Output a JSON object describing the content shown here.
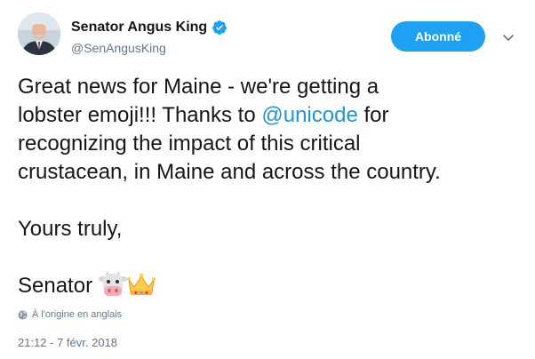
{
  "author": {
    "display_name": "Senator Angus King",
    "handle": "@SenAngusKing",
    "avatar_icon": "avatar-photo",
    "verified_icon": "verified-badge-icon"
  },
  "actions": {
    "follow_label": "Abonné",
    "caret_icon": "chevron-down-icon"
  },
  "tweet": {
    "line1": "Great news for Maine - we're getting a",
    "line2_pre": "lobster emoji!!! Thanks to ",
    "mention": "@unicode",
    "line2_post": " for",
    "line3": "recognizing the impact of this critical",
    "line4": "crustacean, in Maine and across the country.",
    "closing": "Yours truly,",
    "signature": "Senator",
    "signature_emojis": [
      "cow-face-icon",
      "crown-icon"
    ]
  },
  "meta": {
    "translation_note": "À l'origine en anglais",
    "timestamp": "21:12 - 7 févr. 2018"
  },
  "colors": {
    "accent": "#1da1f2",
    "link": "#1b95e0",
    "secondary_text": "#657786",
    "primary_text": "#14171a"
  }
}
